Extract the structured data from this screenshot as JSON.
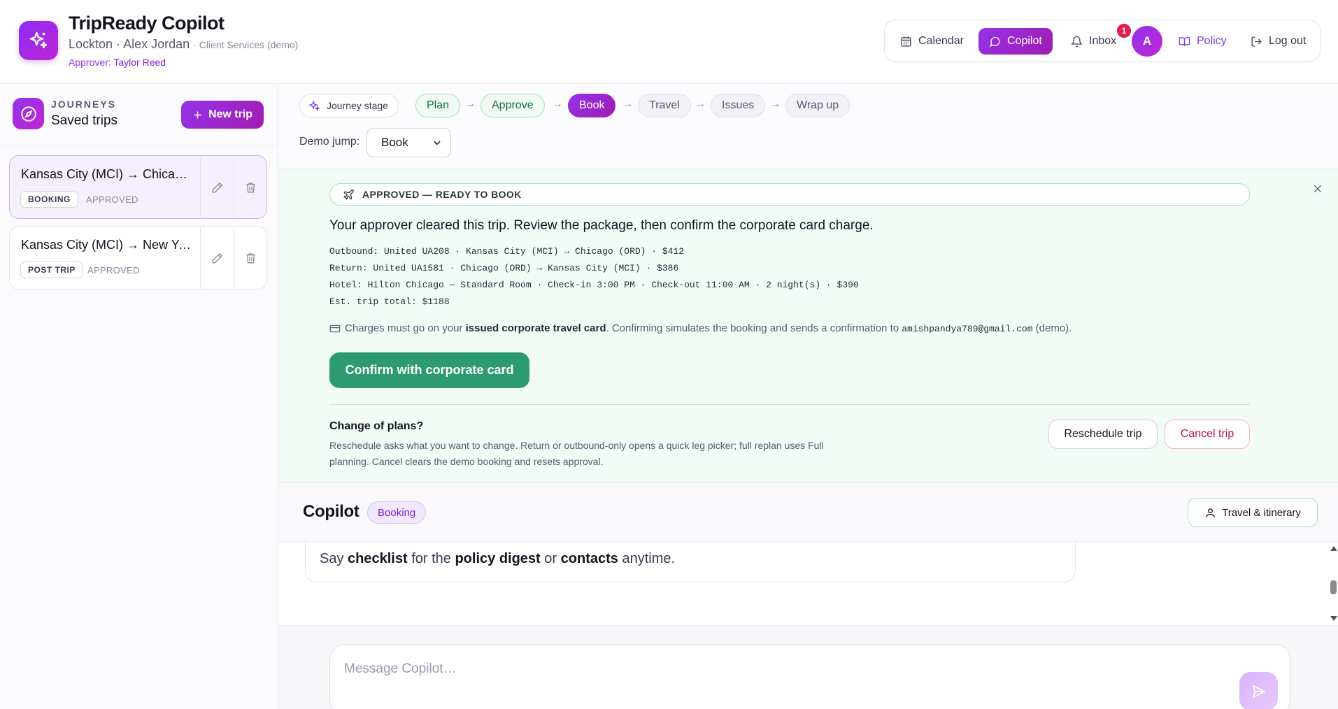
{
  "app": {
    "title": "TripReady Copilot",
    "company": "Lockton",
    "user": "Alex Jordan",
    "department": "Client Services (demo)",
    "approver_label": "Approver:",
    "approver_name": "Taylor Reed",
    "logo_icon": "sparkles-icon"
  },
  "nav": {
    "calendar": "Calendar",
    "copilot": "Copilot",
    "inbox": "Inbox",
    "inbox_count": "1",
    "avatar_initial": "A",
    "policy": "Policy",
    "logout": "Log out"
  },
  "sidebar": {
    "eyebrow": "JOURNEYS",
    "title": "Saved trips",
    "new_trip": "New trip",
    "trips": [
      {
        "title": "Kansas City (MCI) → Chicago (ORD)",
        "tag": "BOOKING",
        "status": "APPROVED",
        "active": true
      },
      {
        "title": "Kansas City (MCI) → New York (JFK)",
        "tag": "POST TRIP",
        "status": "APPROVED",
        "active": false
      }
    ]
  },
  "stages": {
    "label": "Journey stage",
    "items": [
      {
        "label": "Plan",
        "state": "done"
      },
      {
        "label": "Approve",
        "state": "done"
      },
      {
        "label": "Book",
        "state": "current"
      },
      {
        "label": "Travel",
        "state": "todo"
      },
      {
        "label": "Issues",
        "state": "todo"
      },
      {
        "label": "Wrap up",
        "state": "todo"
      }
    ],
    "demo_label": "Demo jump:",
    "demo_value": "Book"
  },
  "booking": {
    "banner": "APPROVED — READY TO BOOK",
    "heading": "Your approver cleared this trip. Review the package, then confirm the corporate card charge.",
    "lines": [
      "Outbound: United UA208 · Kansas City (MCI) → Chicago (ORD) · $412",
      "Return: United UA1581 · Chicago (ORD) → Kansas City (MCI) · $386",
      "Hotel: Hilton Chicago — Standard Room · Check-in 3:00 PM · Check-out 11:00 AM · 2 night(s) · $390",
      "Est. trip total: $1188"
    ],
    "note_prefix": "Charges must go on your",
    "note_bold": "issued corporate travel card",
    "note_middle": ". Confirming simulates the booking and sends a confirmation to",
    "note_email": "amishpandya789@gmail.com",
    "note_suffix": "(demo).",
    "confirm": "Confirm with corporate card",
    "change_title": "Change of plans?",
    "change_desc": "Reschedule asks what you want to change. Return or outbound-only opens a quick leg picker; full replan uses Full planning. Cancel clears the demo booking and resets approval.",
    "reschedule": "Reschedule trip",
    "cancel": "Cancel trip"
  },
  "copilot": {
    "title": "Copilot",
    "badge": "Booking",
    "itinerary_button": "Travel & itinerary"
  },
  "chat": {
    "say": "Say",
    "kw1": "checklist",
    "mid1": "for the",
    "kw2": "policy digest",
    "mid2": "or",
    "kw3": "contacts",
    "end": "anytime."
  },
  "composer": {
    "placeholder": "Message Copilot…"
  },
  "colors": {
    "accent": "#9333ea",
    "confirm": "#2e9a72",
    "danger": "#be123c"
  }
}
